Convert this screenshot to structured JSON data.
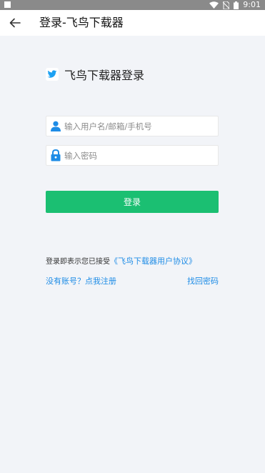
{
  "status_bar": {
    "time": "9:01"
  },
  "app_bar": {
    "title": "登录-飞鸟下载器"
  },
  "brand": {
    "title": "飞鸟下载器登录"
  },
  "username_field": {
    "placeholder": "输入用户名/邮箱/手机号",
    "value": ""
  },
  "password_field": {
    "placeholder": "输入密码",
    "value": ""
  },
  "login_button": {
    "label": "登录"
  },
  "agreement": {
    "prefix": "登录即表示您已接受",
    "link": "《飞鸟下载器用户协议》"
  },
  "links": {
    "register": "没有账号？点我注册",
    "forgot": "找回密码"
  },
  "colors": {
    "accent_green": "#1bbf72",
    "link_blue": "#1e8ce6",
    "background": "#f2f4f8"
  }
}
